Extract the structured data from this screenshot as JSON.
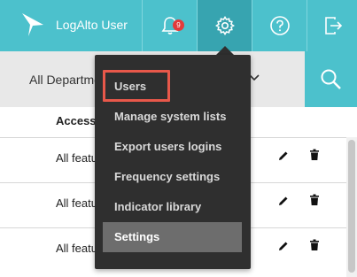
{
  "app": {
    "user_label": "LogAlto User"
  },
  "topbar": {
    "notifications_count": "9",
    "icons": [
      "logo-icon",
      "bell-icon",
      "gear-icon",
      "help-icon",
      "logout-icon"
    ],
    "colors": {
      "bar": "#4cc1cc",
      "active": "#37a4b0",
      "badge": "#e23b3b"
    }
  },
  "filter": {
    "department_text": "All Departments"
  },
  "table": {
    "header_access": "Access",
    "rows": [
      {
        "access": "All features"
      },
      {
        "access": "All features"
      },
      {
        "access": "All features"
      }
    ]
  },
  "menu": {
    "items": [
      {
        "label": "Users"
      },
      {
        "label": "Manage system lists"
      },
      {
        "label": "Export users logins"
      },
      {
        "label": "Frequency settings"
      },
      {
        "label": "Indicator library"
      },
      {
        "label": "Settings"
      }
    ],
    "selected": "Settings",
    "highlighted": "Users",
    "colors": {
      "background": "#2f2f2f",
      "selected": "#6d6d6d",
      "highlight_border": "#e8584a"
    }
  }
}
